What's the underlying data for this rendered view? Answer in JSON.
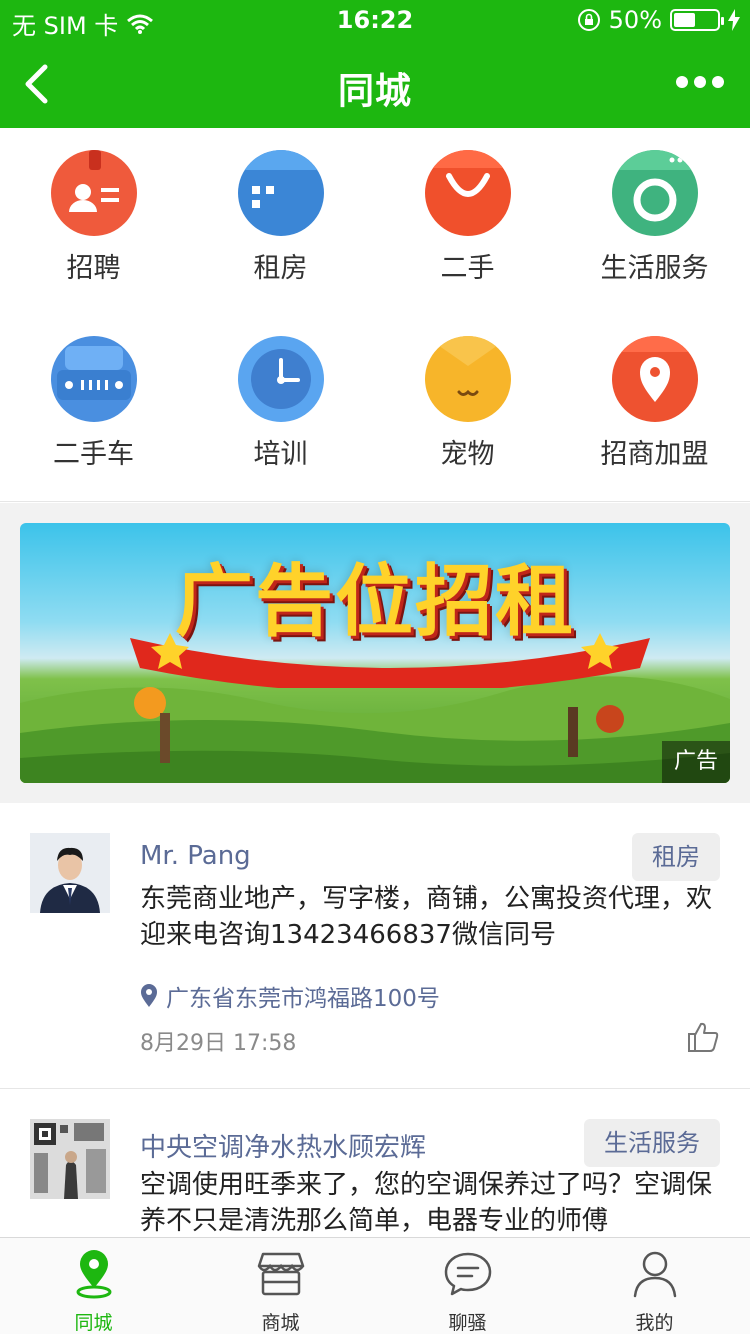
{
  "status_bar": {
    "carrier": "无 SIM 卡",
    "time": "16:22",
    "battery": "50%",
    "battery_level": 0.5
  },
  "nav": {
    "title": "同城"
  },
  "categories": [
    {
      "label": "招聘",
      "icon": "id-card-icon"
    },
    {
      "label": "租房",
      "icon": "building-icon"
    },
    {
      "label": "二手",
      "icon": "shopping-bag-icon"
    },
    {
      "label": "生活服务",
      "icon": "washing-machine-icon"
    },
    {
      "label": "二手车",
      "icon": "car-icon"
    },
    {
      "label": "培训",
      "icon": "clock-icon"
    },
    {
      "label": "宠物",
      "icon": "cat-icon"
    },
    {
      "label": "招商加盟",
      "icon": "location-pin-icon"
    }
  ],
  "ad": {
    "headline": "广告位招租",
    "tag": "广告"
  },
  "posts": [
    {
      "name": "Mr. Pang",
      "category": "租房",
      "content": "东莞商业地产，写字楼，商铺，公寓投资代理，欢迎来电咨询13423466837微信同号",
      "location": "广东省东莞市鸿福路100号",
      "time": "8月29日 17:58"
    },
    {
      "name": "中央空调净水热水顾宏辉",
      "category": "生活服务",
      "content": "空调使用旺季来了，您的空调保养过了吗？空调保养不只是清洗那么简单，电器专业的师傅"
    }
  ],
  "tabs": [
    {
      "label": "同城",
      "icon": "location-pin-icon",
      "active": true
    },
    {
      "label": "商城",
      "icon": "store-icon",
      "active": false
    },
    {
      "label": "聊骚",
      "icon": "chat-bubble-icon",
      "active": false
    },
    {
      "label": "我的",
      "icon": "user-icon",
      "active": false
    }
  ],
  "colors": {
    "brand_green": "#1db710",
    "link_blue": "#5b6b96"
  }
}
